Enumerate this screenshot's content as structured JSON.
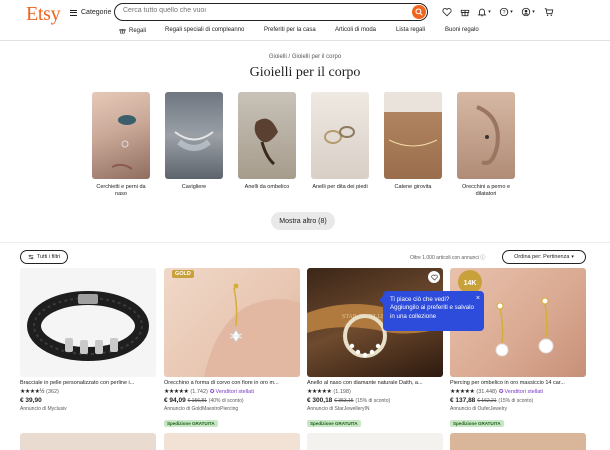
{
  "header": {
    "logo": "Etsy",
    "categories_label": "Categorie",
    "search_placeholder": "Cerca tutto quello che vuoi"
  },
  "nav": {
    "items": [
      {
        "label": "Regali"
      },
      {
        "label": "Regali speciali di compleanno"
      },
      {
        "label": "Preferiti per la casa"
      },
      {
        "label": "Articoli di moda"
      },
      {
        "label": "Lista regali"
      },
      {
        "label": "Buoni regalo"
      }
    ]
  },
  "page": {
    "breadcrumb": "Gioielli / Gioielli per il corpo",
    "title": "Gioielli per il corpo",
    "more_button": "Mostra altro (8)"
  },
  "categories": [
    {
      "label": "Cerchietti e perni da naso",
      "color": "#c9a898"
    },
    {
      "label": "Cavigliere",
      "color": "#8a8f94"
    },
    {
      "label": "Anelli da ombelico",
      "color": "#5a4a3a"
    },
    {
      "label": "Anelli per dita dei piedi",
      "color": "#d8cfc6"
    },
    {
      "label": "Catene girovita",
      "color": "#a47a58"
    },
    {
      "label": "Orecchini a perno e dilatatori",
      "color": "#c4a08a"
    }
  ],
  "toolbar": {
    "filters": "Tutti i filtri",
    "results": "Oltre 1.000 articoli con annunci",
    "sort": "Ordina per: Pertinenza"
  },
  "listings": [
    {
      "title": "Bracciale in pelle personalizzato con perline i...",
      "reviews": "(362)",
      "star_seller": "",
      "price": "€ 39,90",
      "old_price": "",
      "discount": "",
      "shop": "Annuncio di Myclusiv",
      "free_shipping": ""
    },
    {
      "title": "Orecchino a forma di corvo con fiore in oro m...",
      "reviews": "(1.742)",
      "star_seller": "Venditori stellati",
      "price": "€ 94,09",
      "old_price": "€ 156,81",
      "discount": "(40% di sconto)",
      "shop": "Annuncio di GoldMaestroPiercing",
      "free_shipping": "Spedizione GRATUITA",
      "badge": "GOLD"
    },
    {
      "title": "Anello al naso con diamante naturale Daith, a...",
      "reviews": "(1.198)",
      "star_seller": "",
      "price": "€ 300,18",
      "old_price": "€ 353,15",
      "discount": "(15% di sconto)",
      "shop": "Annuncio di StarJewelleryIN",
      "free_shipping": "Spedizione GRATUITA"
    },
    {
      "title": "Piercing per ombelico in oro massiccio 14 car...",
      "reviews": "(31.448)",
      "star_seller": "Venditori stellati",
      "price": "€ 137,88",
      "old_price": "€ 162,21",
      "discount": "(15% di sconto)",
      "shop": "Annuncio di OuferJewelry",
      "free_shipping": "Spedizione GRATUITA"
    }
  ],
  "tooltip": {
    "text": "Ti piace ciò che vedi? Aggiungilo ai preferiti e salvalo in una collezione",
    "close": "×"
  },
  "colors": {
    "brand": "#f1641e",
    "tooltip": "#2d4cdb",
    "star_seller": "#7a3ac4",
    "free_ship_bg": "#c8e7c4"
  }
}
